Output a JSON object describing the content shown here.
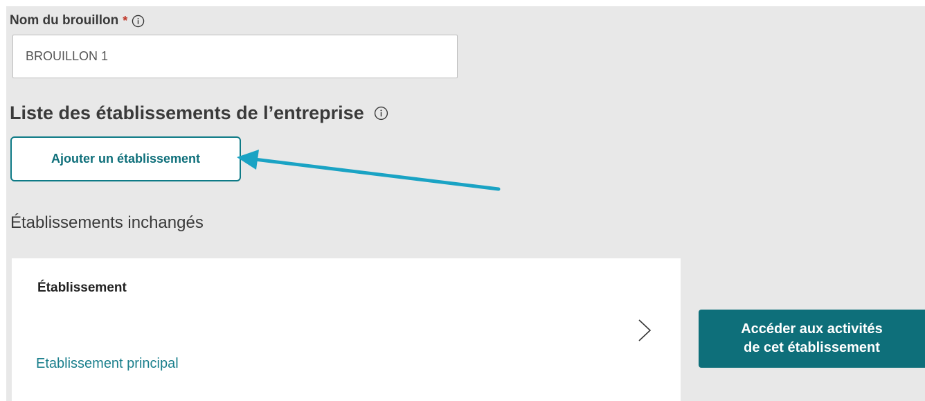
{
  "form": {
    "draft_name_label": "Nom du brouillon",
    "required_mark": "*",
    "draft_name_value": "BROUILLON 1"
  },
  "establishments": {
    "title": "Liste des établissements de l’entreprise",
    "add_button_label": "Ajouter un établissement",
    "unchanged_title": "Établissements inchangés"
  },
  "card": {
    "title": "Établissement",
    "subtitle": "Etablissement principal"
  },
  "actions": {
    "access_line1": "Accéder aux activités",
    "access_line2": "de cet établissement"
  },
  "icons": {
    "info": "info-icon",
    "chevron": "chevron-right-icon",
    "arrow": "annotation-arrow-icon"
  },
  "colors": {
    "accent": "#0e6f7a",
    "link": "#1a7f8c",
    "annotation_arrow": "#1aa3c4",
    "required": "#c0392b",
    "panel_bg": "#e8e8e8"
  }
}
